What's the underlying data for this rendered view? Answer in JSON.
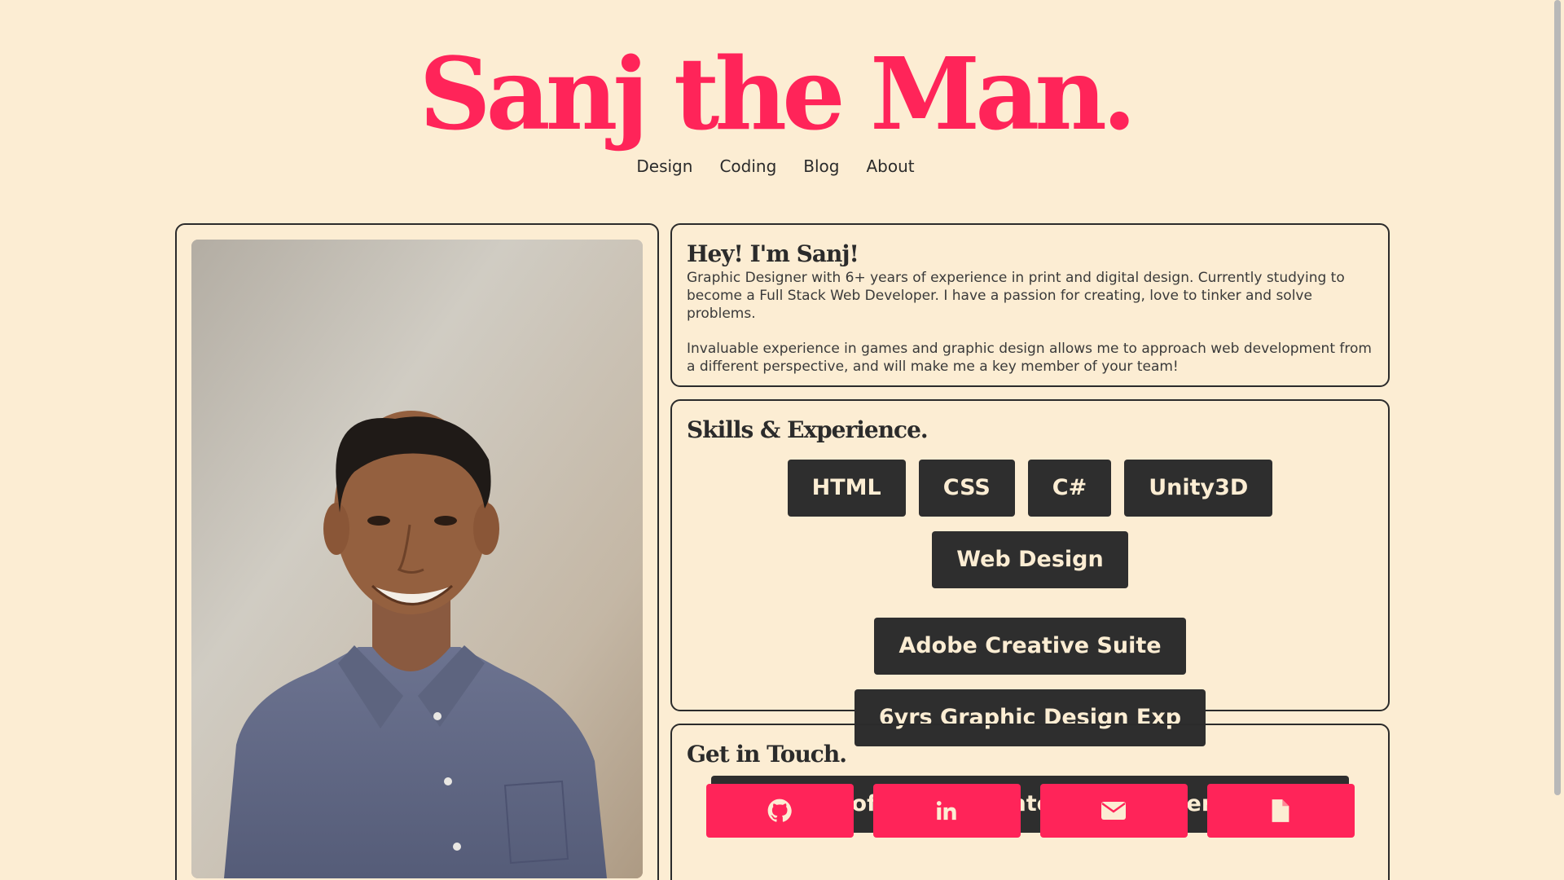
{
  "site": {
    "title": "Sanj the Man.",
    "accent_color": "#ff2459",
    "background_color": "#fcedd3",
    "text_color": "#2b2b2b"
  },
  "nav": {
    "items": [
      "Design",
      "Coding",
      "Blog",
      "About"
    ]
  },
  "intro": {
    "heading": "Hey! I'm Sanj!",
    "paragraph_1": "Graphic Designer with 6+ years of experience in print and digital design. Currently studying to become a Full Stack Web Developer. I have a passion for creating, love to tinker and solve problems.",
    "paragraph_2": "Invaluable experience in games and graphic design allows me to approach web development from a different perspective, and will make me a key member of your team!"
  },
  "skills": {
    "heading": "Skills & Experience.",
    "tags": [
      "HTML",
      "CSS",
      "C#",
      "Unity3D",
      "Web Design",
      "Adobe Creative Suite",
      "6yrs Graphic Design Exp",
      "Bachelor of Games & Interactive Entertainment"
    ]
  },
  "contact": {
    "heading": "Get in Touch.",
    "buttons": [
      {
        "icon": "github-icon"
      },
      {
        "icon": "linkedin-icon"
      },
      {
        "icon": "email-icon"
      },
      {
        "icon": "resume-file-icon"
      }
    ]
  },
  "photo": {
    "subject": "portrait-photo"
  }
}
